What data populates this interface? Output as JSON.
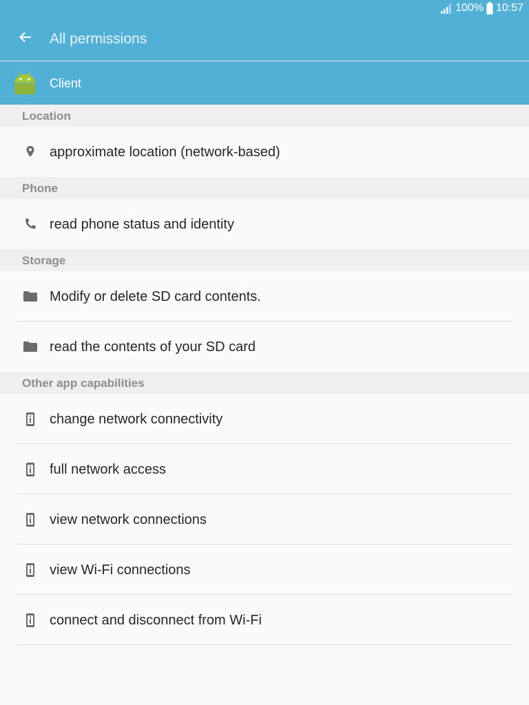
{
  "status_bar": {
    "battery_percent": "100%",
    "time": "10:57",
    "icons": [
      "signal-icon",
      "battery-icon"
    ]
  },
  "app_bar": {
    "title": "All permissions",
    "back_icon": "arrow-back-icon"
  },
  "app_info": {
    "name": "Client",
    "icon": "android-icon"
  },
  "colors": {
    "app_bar": "#52b0d6",
    "section_background": "#efefef",
    "section_text": "#8c8c8c",
    "list_text": "#262626",
    "icon": "#6b6b6b"
  },
  "sections": [
    {
      "title": "Location",
      "items": [
        {
          "label": "approximate location (network-based)",
          "icon": "location-pin-icon"
        }
      ]
    },
    {
      "title": "Phone",
      "items": [
        {
          "label": "read phone status and identity",
          "icon": "phone-icon"
        }
      ]
    },
    {
      "title": "Storage",
      "items": [
        {
          "label": "Modify or delete SD card contents.",
          "icon": "folder-icon"
        },
        {
          "label": "read the contents of your SD card",
          "icon": "folder-icon"
        }
      ]
    },
    {
      "title": "Other app capabilities",
      "items": [
        {
          "label": "change network connectivity",
          "icon": "device-info-icon"
        },
        {
          "label": "full network access",
          "icon": "device-info-icon"
        },
        {
          "label": "view network connections",
          "icon": "device-info-icon"
        },
        {
          "label": "view Wi-Fi connections",
          "icon": "device-info-icon"
        },
        {
          "label": "connect and disconnect from Wi-Fi",
          "icon": "device-info-icon"
        }
      ]
    }
  ]
}
